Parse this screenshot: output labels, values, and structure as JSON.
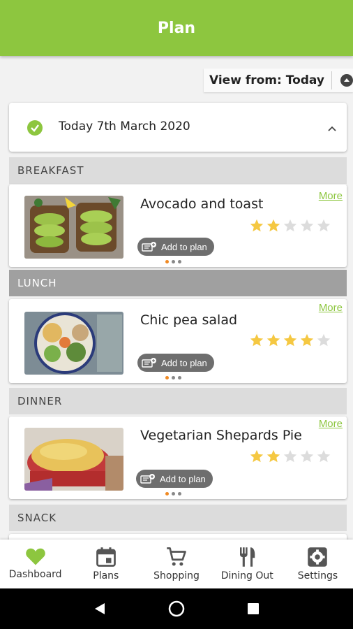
{
  "app": {
    "title": "Plan",
    "accent": "#8dc63f"
  },
  "view_from": {
    "label": "View from: Today"
  },
  "date_card": {
    "label": "Today 7th March 2020"
  },
  "sections": {
    "breakfast": "BREAKFAST",
    "lunch": "LUNCH",
    "dinner": "DINNER",
    "snack": "SNACK"
  },
  "meals": [
    {
      "name": "Avocado and toast",
      "more": "More",
      "rating": 2,
      "max_rating": 5,
      "add_label": "Add to plan"
    },
    {
      "name": "Chic pea salad",
      "more": "More",
      "rating": 4,
      "max_rating": 5,
      "add_label": "Add to plan"
    },
    {
      "name": "Vegetarian Shepards Pie",
      "more": "More",
      "rating": 2,
      "max_rating": 5,
      "add_label": "Add to plan"
    }
  ],
  "bottom_nav": [
    {
      "label": "Dashboard",
      "icon": "heart-icon",
      "color": "#8dc63f"
    },
    {
      "label": "Plans",
      "icon": "calendar-icon",
      "color": "#555555"
    },
    {
      "label": "Shopping",
      "icon": "cart-icon",
      "color": "#555555"
    },
    {
      "label": "Dining Out",
      "icon": "cutlery-icon",
      "color": "#555555"
    },
    {
      "label": "Settings",
      "icon": "gear-icon",
      "color": "#555555"
    }
  ],
  "system_nav": [
    "back-icon",
    "home-icon",
    "recents-icon"
  ]
}
